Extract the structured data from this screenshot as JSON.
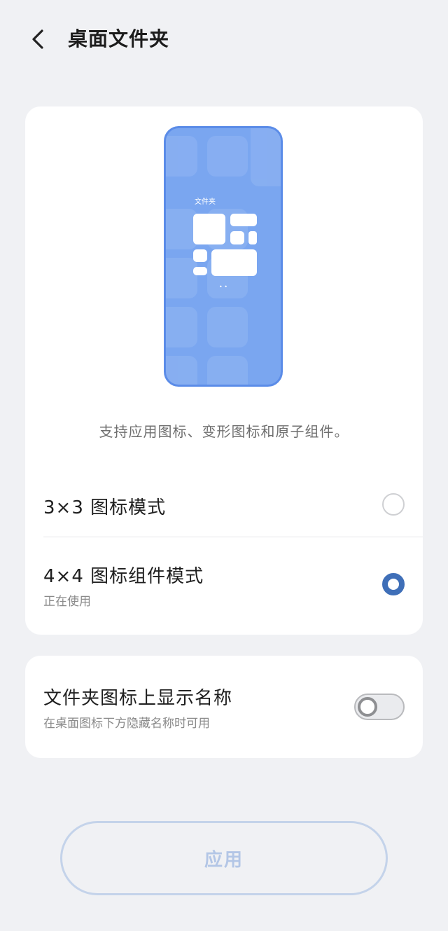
{
  "header": {
    "back_icon": "chevron-left-icon",
    "title": "桌面文件夹"
  },
  "preview": {
    "folder_label": "文件夹",
    "page_dots": "• •",
    "colors": {
      "phone_body": "#7aa6f0",
      "phone_border": "#5b8ce8",
      "widget": "#ffffff"
    },
    "caption": "支持应用图标、变形图标和原子组件。"
  },
  "options": [
    {
      "label": "3×3 图标模式",
      "sub": "",
      "selected": false
    },
    {
      "label": "4×4 图标组件模式",
      "sub": "正在使用",
      "selected": true
    }
  ],
  "setting": {
    "title": "文件夹图标上显示名称",
    "subtitle": "在桌面图标下方隐藏名称时可用",
    "enabled": false
  },
  "apply_button": {
    "label": "应用",
    "enabled": false
  },
  "colors": {
    "background": "#f0f1f4",
    "card": "#ffffff",
    "accent": "#3f6fb8",
    "apply_border": "#c4d3ea",
    "apply_text": "#b3c6e6"
  }
}
